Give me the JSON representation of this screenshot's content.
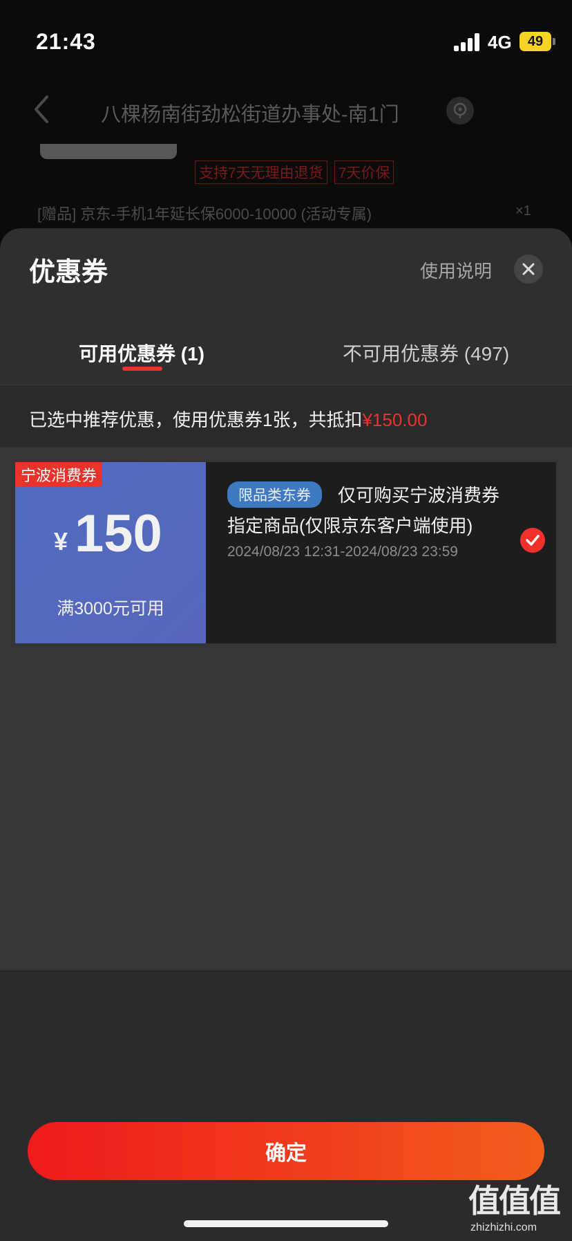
{
  "status_bar": {
    "time": "21:43",
    "network": "4G",
    "battery": "49"
  },
  "background": {
    "address": "八棵杨南街劲松街道办事处-南1门",
    "tags": [
      "支持7天无理由退货",
      "7天价保"
    ],
    "gift_line": "[赠品] 京东-手机1年延长保6000-10000 (活动专属)",
    "gift_qty": "×1"
  },
  "sheet": {
    "title": "优惠券",
    "help_link": "使用说明",
    "tabs": [
      {
        "label": "可用优惠券 (1)",
        "active": true
      },
      {
        "label": "不可用优惠券 (497)",
        "active": false
      }
    ],
    "summary": {
      "text": "已选中推荐优惠，使用优惠券1张，共抵扣",
      "amount": "¥150.00"
    }
  },
  "coupons": [
    {
      "type_tag": "宁波消费券",
      "currency": "¥",
      "value": "150",
      "condition": "满3000元可用",
      "scope_tag": "限品类东券",
      "desc_line1": "仅可购买宁波消费券",
      "desc_line2": "指定商品(仅限京东客户端使用)",
      "valid_period": "2024/08/23 12:31-2024/08/23 23:59",
      "selected": true
    }
  ],
  "footer": {
    "confirm_label": "确定"
  },
  "watermark": {
    "top": "值值值",
    "bottom": "zhizhizhi.com"
  },
  "colors": {
    "accent": "#f0302a",
    "coupon_blue": "#4f6cc1",
    "scope_tag_blue": "#3f79c2"
  }
}
